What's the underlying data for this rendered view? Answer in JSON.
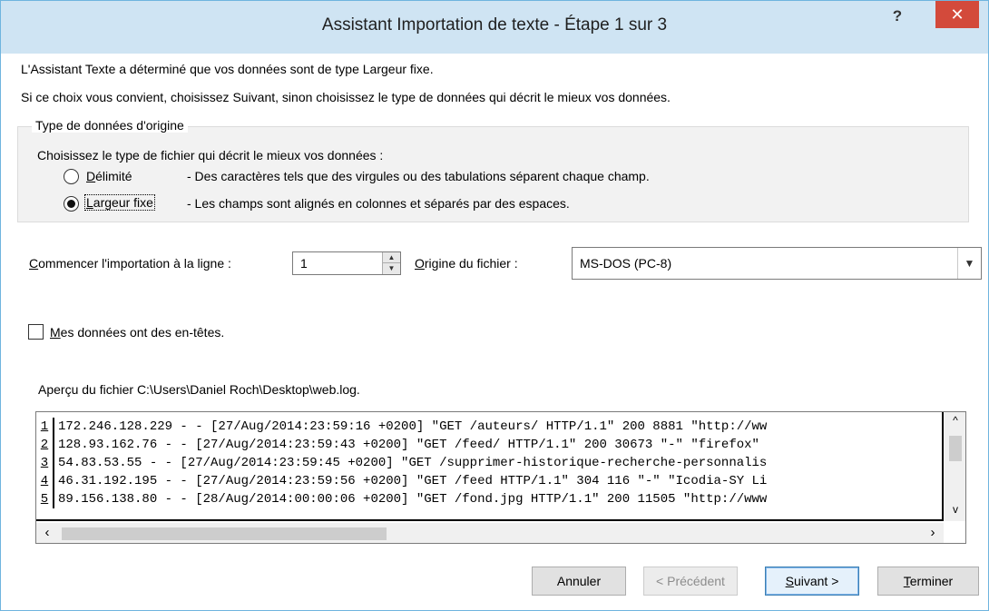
{
  "window": {
    "title": "Assistant Importation de texte - Étape 1 sur 3",
    "help_label": "?",
    "close_label": "✕"
  },
  "intro": {
    "line1": "L'Assistant Texte a déterminé que vos données sont de type Largeur fixe.",
    "line2": "Si ce choix vous convient, choisissez Suivant, sinon choisissez le type de données qui décrit le mieux vos données."
  },
  "group": {
    "legend": "Type de données d'origine",
    "prompt": "Choisissez le type de fichier qui décrit le mieux vos données :",
    "options": [
      {
        "label_underlined": "D",
        "label_rest": "élimité",
        "description": "- Des caractères tels que des virgules ou des tabulations séparent chaque champ.",
        "selected": false
      },
      {
        "label_underlined": "L",
        "label_rest": "argeur fixe",
        "description": "- Les champs sont alignés en colonnes et séparés par des espaces.",
        "selected": true
      }
    ]
  },
  "start_row": {
    "label_underlined": "C",
    "label_rest": "ommencer l'importation à la ligne :",
    "value": "1"
  },
  "file_origin": {
    "label_underlined": "O",
    "label_rest": "rigine du fichier :",
    "value": "MS-DOS (PC-8)"
  },
  "headers_checkbox": {
    "label_underlined": "M",
    "label_rest": "es données ont des en-têtes.",
    "checked": false
  },
  "preview": {
    "title": "Aperçu du fichier C:\\Users\\Daniel Roch\\Desktop\\web.log.",
    "rows": [
      {
        "num": "1",
        "text": "172.246.128.229 - - [27/Aug/2014:23:59:16 +0200] \"GET /auteurs/ HTTP/1.1\" 200 8881 \"http://ww"
      },
      {
        "num": "2",
        "text": "128.93.162.76 - - [27/Aug/2014:23:59:43 +0200] \"GET /feed/ HTTP/1.1\" 200 30673 \"-\" \"firefox\""
      },
      {
        "num": "3",
        "text": "54.83.53.55 - - [27/Aug/2014:23:59:45 +0200] \"GET /supprimer-historique-recherche-personnalis"
      },
      {
        "num": "4",
        "text": "46.31.192.195 - - [27/Aug/2014:23:59:56 +0200] \"GET /feed HTTP/1.1\" 304 116 \"-\" \"Icodia-SY Li"
      },
      {
        "num": "5",
        "text": "89.156.138.80 - - [28/Aug/2014:00:00:06 +0200] \"GET /fond.jpg HTTP/1.1\" 200 11505 \"http://www"
      }
    ]
  },
  "buttons": {
    "cancel": "Annuler",
    "previous": "< Précédent",
    "next_underlined": "S",
    "next_rest": "uivant >",
    "finish_underlined": "T",
    "finish_rest": "erminer"
  }
}
